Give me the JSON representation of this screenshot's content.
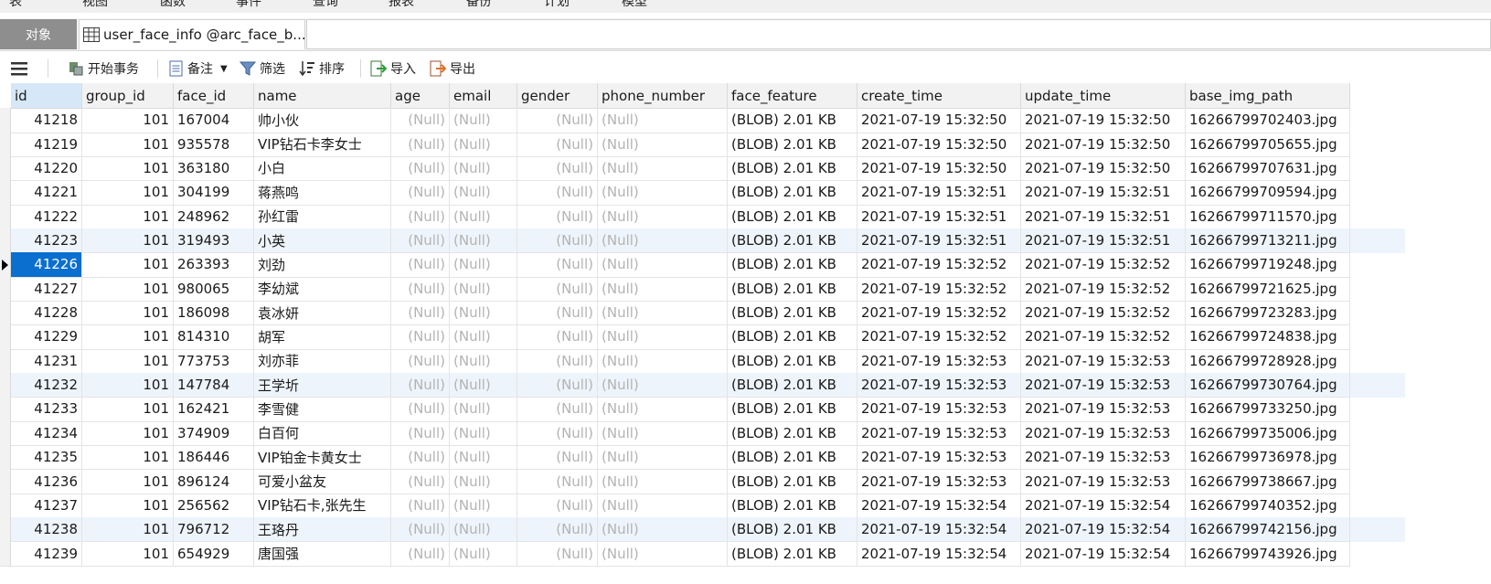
{
  "menu": [
    "表",
    "视图",
    "函数",
    "事件",
    "查询",
    "报表",
    "备份",
    "计划",
    "模型"
  ],
  "tabs": {
    "objects": "对象",
    "table_tab": "user_face_info @arc_face_b..."
  },
  "toolbar": {
    "menu_icon": "hamburger-icon",
    "begin_tx": "开始事务",
    "comment": "备注",
    "filter": "筛选",
    "sort": "排序",
    "import": "导入",
    "export": "导出"
  },
  "columns": [
    "id",
    "group_id",
    "face_id",
    "name",
    "age",
    "email",
    "gender",
    "phone_number",
    "face_feature",
    "create_time",
    "update_time",
    "base_img_path"
  ],
  "null_text": "(Null)",
  "rows": [
    {
      "id": "41218",
      "group_id": "101",
      "face_id": "167004",
      "name": "帅小伙",
      "face_feature": "(BLOB) 2.01 KB",
      "create_time": "2021-07-19 15:32:50",
      "update_time": "2021-07-19 15:32:50",
      "base_img_path": "16266799702403.jpg"
    },
    {
      "id": "41219",
      "group_id": "101",
      "face_id": "935578",
      "name": "VIP钻石卡李女士",
      "face_feature": "(BLOB) 2.01 KB",
      "create_time": "2021-07-19 15:32:50",
      "update_time": "2021-07-19 15:32:50",
      "base_img_path": "16266799705655.jpg"
    },
    {
      "id": "41220",
      "group_id": "101",
      "face_id": "363180",
      "name": "小白",
      "face_feature": "(BLOB) 2.01 KB",
      "create_time": "2021-07-19 15:32:50",
      "update_time": "2021-07-19 15:32:50",
      "base_img_path": "16266799707631.jpg"
    },
    {
      "id": "41221",
      "group_id": "101",
      "face_id": "304199",
      "name": "蒋燕鸣",
      "face_feature": "(BLOB) 2.01 KB",
      "create_time": "2021-07-19 15:32:51",
      "update_time": "2021-07-19 15:32:51",
      "base_img_path": "16266799709594.jpg"
    },
    {
      "id": "41222",
      "group_id": "101",
      "face_id": "248962",
      "name": "孙红雷",
      "face_feature": "(BLOB) 2.01 KB",
      "create_time": "2021-07-19 15:32:51",
      "update_time": "2021-07-19 15:32:51",
      "base_img_path": "16266799711570.jpg"
    },
    {
      "id": "41223",
      "group_id": "101",
      "face_id": "319493",
      "name": "小英",
      "face_feature": "(BLOB) 2.01 KB",
      "create_time": "2021-07-19 15:32:51",
      "update_time": "2021-07-19 15:32:51",
      "base_img_path": "16266799713211.jpg"
    },
    {
      "id": "41226",
      "group_id": "101",
      "face_id": "263393",
      "name": "刘劲",
      "face_feature": "(BLOB) 2.01 KB",
      "create_time": "2021-07-19 15:32:52",
      "update_time": "2021-07-19 15:32:52",
      "base_img_path": "16266799719248.jpg"
    },
    {
      "id": "41227",
      "group_id": "101",
      "face_id": "980065",
      "name": "李幼斌",
      "face_feature": "(BLOB) 2.01 KB",
      "create_time": "2021-07-19 15:32:52",
      "update_time": "2021-07-19 15:32:52",
      "base_img_path": "16266799721625.jpg"
    },
    {
      "id": "41228",
      "group_id": "101",
      "face_id": "186098",
      "name": "袁冰妍",
      "face_feature": "(BLOB) 2.01 KB",
      "create_time": "2021-07-19 15:32:52",
      "update_time": "2021-07-19 15:32:52",
      "base_img_path": "16266799723283.jpg"
    },
    {
      "id": "41229",
      "group_id": "101",
      "face_id": "814310",
      "name": "胡军",
      "face_feature": "(BLOB) 2.01 KB",
      "create_time": "2021-07-19 15:32:52",
      "update_time": "2021-07-19 15:32:52",
      "base_img_path": "16266799724838.jpg"
    },
    {
      "id": "41231",
      "group_id": "101",
      "face_id": "773753",
      "name": "刘亦菲",
      "face_feature": "(BLOB) 2.01 KB",
      "create_time": "2021-07-19 15:32:53",
      "update_time": "2021-07-19 15:32:53",
      "base_img_path": "16266799728928.jpg"
    },
    {
      "id": "41232",
      "group_id": "101",
      "face_id": "147784",
      "name": "王学圻",
      "face_feature": "(BLOB) 2.01 KB",
      "create_time": "2021-07-19 15:32:53",
      "update_time": "2021-07-19 15:32:53",
      "base_img_path": "16266799730764.jpg"
    },
    {
      "id": "41233",
      "group_id": "101",
      "face_id": "162421",
      "name": "李雪健",
      "face_feature": "(BLOB) 2.01 KB",
      "create_time": "2021-07-19 15:32:53",
      "update_time": "2021-07-19 15:32:53",
      "base_img_path": "16266799733250.jpg"
    },
    {
      "id": "41234",
      "group_id": "101",
      "face_id": "374909",
      "name": "白百何",
      "face_feature": "(BLOB) 2.01 KB",
      "create_time": "2021-07-19 15:32:53",
      "update_time": "2021-07-19 15:32:53",
      "base_img_path": "16266799735006.jpg"
    },
    {
      "id": "41235",
      "group_id": "101",
      "face_id": "186446",
      "name": "VIP铂金卡黄女士",
      "face_feature": "(BLOB) 2.01 KB",
      "create_time": "2021-07-19 15:32:53",
      "update_time": "2021-07-19 15:32:53",
      "base_img_path": "16266799736978.jpg"
    },
    {
      "id": "41236",
      "group_id": "101",
      "face_id": "896124",
      "name": "可爱小盆友",
      "face_feature": "(BLOB) 2.01 KB",
      "create_time": "2021-07-19 15:32:53",
      "update_time": "2021-07-19 15:32:53",
      "base_img_path": "16266799738667.jpg"
    },
    {
      "id": "41237",
      "group_id": "101",
      "face_id": "256562",
      "name": "VIP钻石卡,张先生",
      "face_feature": "(BLOB) 2.01 KB",
      "create_time": "2021-07-19 15:32:54",
      "update_time": "2021-07-19 15:32:54",
      "base_img_path": "16266799740352.jpg"
    },
    {
      "id": "41238",
      "group_id": "101",
      "face_id": "796712",
      "name": "王珞丹",
      "face_feature": "(BLOB) 2.01 KB",
      "create_time": "2021-07-19 15:32:54",
      "update_time": "2021-07-19 15:32:54",
      "base_img_path": "16266799742156.jpg"
    },
    {
      "id": "41239",
      "group_id": "101",
      "face_id": "654929",
      "name": "唐国强",
      "face_feature": "(BLOB) 2.01 KB",
      "create_time": "2021-07-19 15:32:54",
      "update_time": "2021-07-19 15:32:54",
      "base_img_path": "16266799743926.jpg"
    }
  ],
  "selected_row_index": 6,
  "alt_row_indices": [
    5,
    11,
    17
  ]
}
